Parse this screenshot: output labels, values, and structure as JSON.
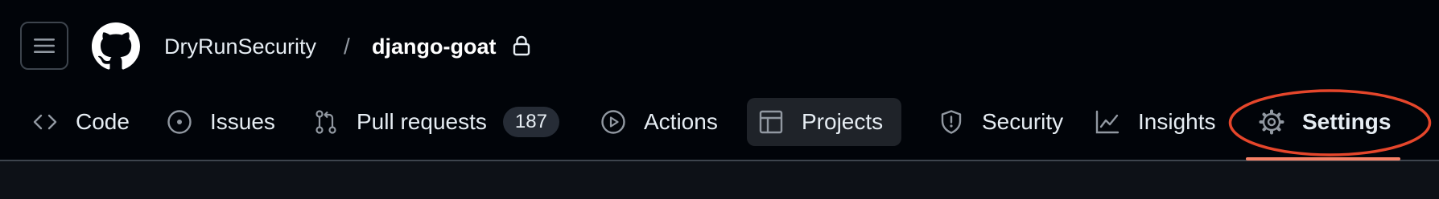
{
  "header": {
    "owner": "DryRunSecurity",
    "separator": "/",
    "repo": "django-goat",
    "visibility_icon": "lock-icon",
    "menu_icon": "hamburger-icon",
    "logo_icon": "github-logo-icon"
  },
  "tabs": [
    {
      "label": "Code",
      "icon": "code-icon"
    },
    {
      "label": "Issues",
      "icon": "issue-opened-icon"
    },
    {
      "label": "Pull requests",
      "icon": "git-pull-request-icon",
      "count": "187"
    },
    {
      "label": "Actions",
      "icon": "play-icon"
    },
    {
      "label": "Projects",
      "icon": "table-icon"
    },
    {
      "label": "Security",
      "icon": "shield-icon"
    },
    {
      "label": "Insights",
      "icon": "graph-icon"
    },
    {
      "label": "Settings",
      "icon": "gear-icon",
      "selected": true
    }
  ],
  "colors": {
    "background": "#010409",
    "text": "#e6edf3",
    "selected_underline": "#f78166",
    "annotation_circle": "#e5462b"
  }
}
